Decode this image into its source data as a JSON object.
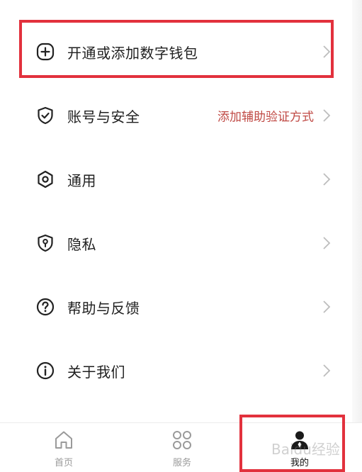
{
  "menu": {
    "items": [
      {
        "label": "开通或添加数字钱包",
        "icon": "plus-circle-icon",
        "hint": ""
      },
      {
        "label": "账号与安全",
        "icon": "shield-check-icon",
        "hint": "添加辅助验证方式"
      },
      {
        "label": "通用",
        "icon": "hexagon-settings-icon",
        "hint": ""
      },
      {
        "label": "隐私",
        "icon": "privacy-lock-icon",
        "hint": ""
      },
      {
        "label": "帮助与反馈",
        "icon": "help-circle-icon",
        "hint": ""
      },
      {
        "label": "关于我们",
        "icon": "info-circle-icon",
        "hint": ""
      }
    ]
  },
  "tabbar": {
    "tabs": [
      {
        "label": "首页",
        "icon": "home-icon",
        "active": false
      },
      {
        "label": "服务",
        "icon": "grid-icon",
        "active": false
      },
      {
        "label": "我的",
        "icon": "person-icon",
        "active": true
      }
    ]
  },
  "watermark": {
    "text": "Baidu经验"
  },
  "colors": {
    "highlight": "#e2313d",
    "hint_text": "#c04a45",
    "text_primary": "#1f1f1f",
    "text_muted": "#9a9a9a"
  }
}
